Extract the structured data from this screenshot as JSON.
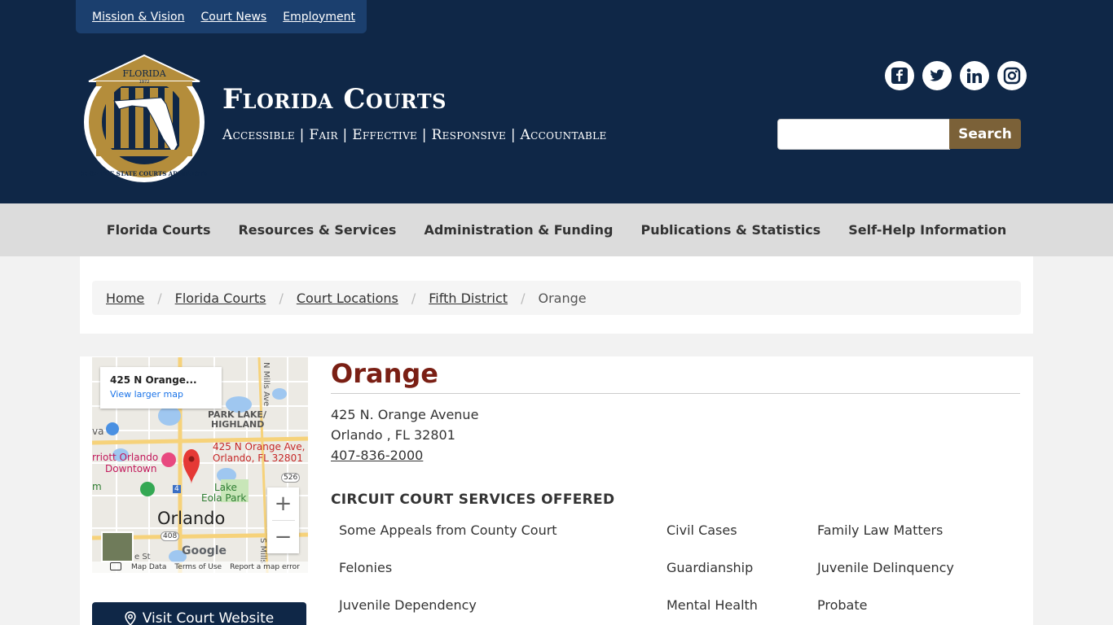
{
  "top_links": [
    "Mission & Vision",
    "Court News",
    "Employment"
  ],
  "site": {
    "title": "Florida Courts",
    "tagline": "Accessible | Fair | Effective | Responsive | Accountable",
    "seal_text": [
      "FLORIDA",
      "1972",
      "OFFICE OF THE STATE COURTS ADMINISTRATOR"
    ]
  },
  "socials": [
    {
      "name": "facebook-icon",
      "glyph": "f"
    },
    {
      "name": "twitter-icon",
      "glyph": "🐦"
    },
    {
      "name": "linkedin-icon",
      "glyph": "in"
    },
    {
      "name": "instagram-icon",
      "glyph": "◎"
    }
  ],
  "search": {
    "placeholder": "",
    "button_label": "Search"
  },
  "nav": [
    "Florida Courts",
    "Resources & Services",
    "Administration & Funding",
    "Publications & Statistics",
    "Self-Help Information"
  ],
  "breadcrumb": {
    "links": [
      "Home",
      "Florida Courts",
      "Court Locations",
      "Fifth District"
    ],
    "separator": "/",
    "current": "Orange"
  },
  "map": {
    "card_title": "425 N Orange...",
    "card_link": "View larger map",
    "labels": {
      "park_lake": "PARK LAKE/",
      "highland": "HIGHLAND",
      "address_1": "425 N Orange Ave,",
      "address_2": "Orlando, FL 32801",
      "marriott_1": "rriott Orlando",
      "marriott_2": "Downtown",
      "lake": "Lake",
      "eola": "Eola Park",
      "city": "Orlando",
      "mills": "N Mills Ave",
      "route_526": "526",
      "route_408": "408",
      "route_4": "4",
      "left_va": "va",
      "left_m": "m",
      "e_st": "e St",
      "s_mills": "S Mills"
    },
    "zoom_in": "+",
    "zoom_out": "−",
    "footer": [
      "Map Data",
      "Terms of Use",
      "Report a map error"
    ],
    "google": "Google",
    "colors": {
      "pin": "#e53935",
      "water": "#9fc7f0",
      "road": "#f6d27a"
    }
  },
  "visit_button": "Visit Court Website",
  "court": {
    "name": "Orange",
    "address_line1": "425 N. Orange Avenue",
    "address_line2": "Orlando , FL 32801",
    "phone": "407-836-2000",
    "services_heading": "CIRCUIT COURT SERVICES OFFERED",
    "services": [
      "Some Appeals from County Court",
      "Civil Cases",
      "Family Law Matters",
      "Felonies",
      "Guardianship",
      "Juvenile Delinquency",
      "Juvenile Dependency",
      "Mental Health",
      "Probate"
    ]
  },
  "colors": {
    "header_bg": "#0f2747",
    "accent_gold": "#7b6138",
    "title_red": "#7a1f14"
  }
}
